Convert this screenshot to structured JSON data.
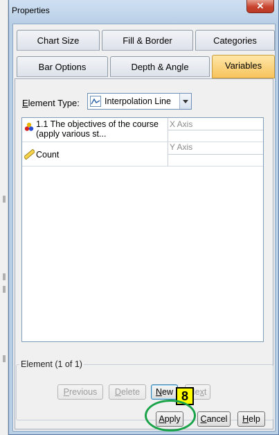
{
  "window": {
    "title": "Properties",
    "close_glyph": "✕"
  },
  "tabs": [
    {
      "label": "Chart Size",
      "active": false
    },
    {
      "label": "Fill & Border",
      "active": false
    },
    {
      "label": "Categories",
      "active": false
    },
    {
      "label": "Bar Options",
      "active": false
    },
    {
      "label": "Depth & Angle",
      "active": false
    },
    {
      "label": "Variables",
      "active": true
    }
  ],
  "element_type": {
    "label_prefix": "E",
    "label_rest": "lement Type:",
    "value": "Interpolation Line",
    "icon": "line-chart-icon"
  },
  "variables": [
    {
      "name_line1": "1.1 The objectives of the course",
      "name_line2": "(apply various st...",
      "axis": "X Axis",
      "icon": "nominal-variable-icon"
    },
    {
      "name_line1": "Count",
      "name_line2": "",
      "axis": "Y Axis",
      "icon": "scale-variable-icon"
    }
  ],
  "element_group": {
    "label": "Element (1 of 1)"
  },
  "buttons": {
    "previous": {
      "mnemonic": "P",
      "rest": "revious"
    },
    "delete": {
      "mnemonic": "D",
      "rest": "elete"
    },
    "new": {
      "mnemonic": "N",
      "rest": "ew"
    },
    "next": {
      "mnemonic": "x",
      "before": "Ne",
      "rest": "t"
    },
    "apply": {
      "mnemonic": "A",
      "rest": "pply"
    },
    "cancel": {
      "mnemonic": "C",
      "rest": "ancel"
    },
    "help": {
      "mnemonic": "H",
      "rest": "elp"
    }
  },
  "annotation": {
    "step_number": "8",
    "callout_color": "#ffff00",
    "ring_color": "#1ba34a"
  }
}
